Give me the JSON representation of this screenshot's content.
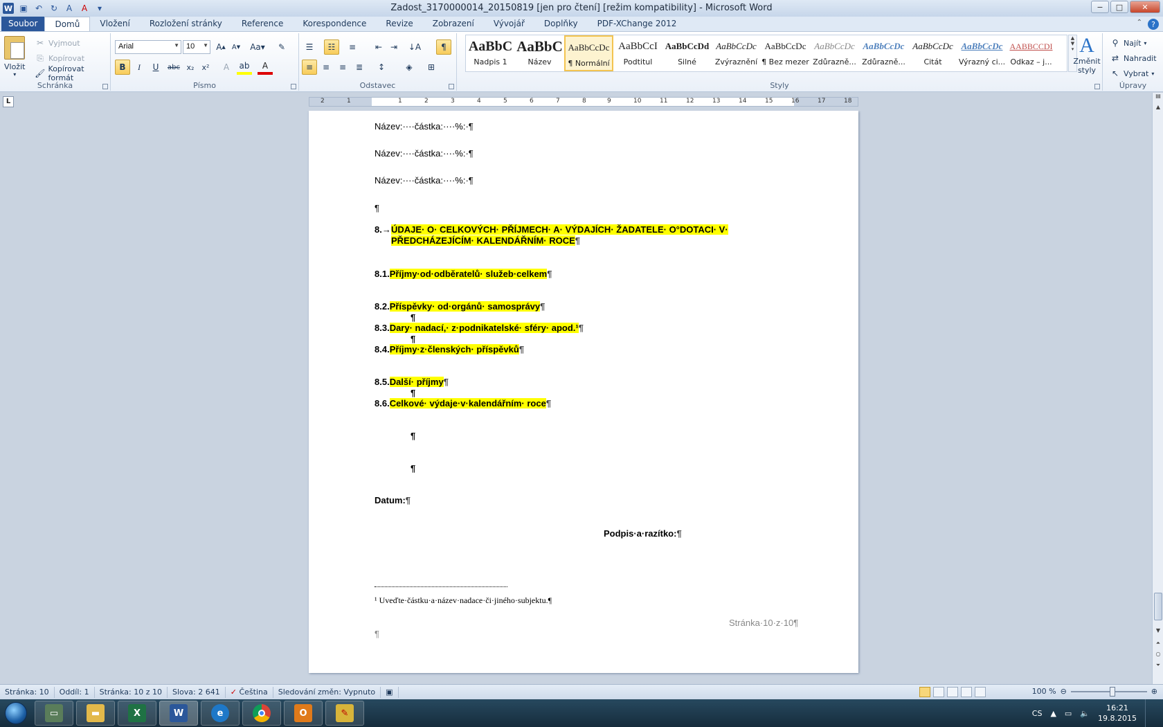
{
  "window": {
    "title": "Zadost_3170000014_20150819 [jen pro čtení] [režim kompatibility] - Microsoft Word",
    "controls": [
      "−",
      "□",
      "✕"
    ]
  },
  "tabs": [
    "Soubor",
    "Domů",
    "Vložení",
    "Rozložení stránky",
    "Reference",
    "Korespondence",
    "Revize",
    "Zobrazení",
    "Vývojář",
    "Doplňky",
    "PDF-XChange 2012"
  ],
  "ribbon": {
    "clipboard": {
      "label": "Schránka",
      "paste": "Vložit",
      "cut": "Vyjmout",
      "copy": "Kopírovat",
      "format_painter": "Kopírovat formát"
    },
    "font": {
      "label": "Písmo",
      "font_name": "Arial",
      "font_size": "10"
    },
    "paragraph": {
      "label": "Odstavec"
    },
    "styles": {
      "label": "Styly",
      "items": [
        {
          "preview": "AaBbC",
          "name": "Nadpis 1"
        },
        {
          "preview": "AaBbC",
          "name": "Název"
        },
        {
          "preview": "AaBbCcDc",
          "name": "¶ Normální"
        },
        {
          "preview": "AaBbCcI",
          "name": "Podtitul"
        },
        {
          "preview": "AaBbCcDd",
          "name": "Silné"
        },
        {
          "preview": "AaBbCcDc",
          "name": "Zvýraznění"
        },
        {
          "preview": "AaBbCcDc",
          "name": "¶ Bez mezer"
        },
        {
          "preview": "AaBbCcDc",
          "name": "Zdůrazně..."
        },
        {
          "preview": "AaBbCcDc",
          "name": "Zdůrazně..."
        },
        {
          "preview": "AaBbCcDc",
          "name": "Citát"
        },
        {
          "preview": "AaBbCcDc",
          "name": "Výrazný ci..."
        },
        {
          "preview": "AABBCCDI",
          "name": "Odkaz – j..."
        }
      ],
      "change_styles": "Změnit styly"
    },
    "editing": {
      "label": "Úpravy",
      "find": "Najít",
      "replace": "Nahradit",
      "select": "Vybrat"
    }
  },
  "ruler": {
    "numbers": [
      "2",
      "1",
      "1",
      "2",
      "3",
      "4",
      "5",
      "6",
      "7",
      "8",
      "9",
      "10",
      "11",
      "12",
      "13",
      "14",
      "15",
      "16",
      "17",
      "18"
    ]
  },
  "document": {
    "field_line": "Název:····částka:····%:·¶",
    "empty_pm": "¶",
    "heading8_num": "8.→",
    "heading8_line1": "ÚDAJE· O· CELKOVÝCH· PŘÍJMECH· A· VÝDAJÍCH· ŽADATELE· O°DOTACI· V·",
    "heading8_line2": "PŘEDCHÁZEJÍCÍM· KALENDÁŘNÍM· ROCE",
    "items": [
      {
        "num": "8.1.",
        "text": "Příjmy·od·odběratelů· služeb·celkem"
      },
      {
        "num": "8.2.",
        "text": "Příspěvky· od·orgánů· samosprávy"
      },
      {
        "num": "8.3.",
        "text": "Dary· nadací,· z·podnikatelské· sféry· apod.¹"
      },
      {
        "num": "8.4.",
        "text": "Příjmy·z·členských· příspěvků"
      },
      {
        "num": "8.5.",
        "text": "Další· příjmy"
      },
      {
        "num": "8.6.",
        "text": "Celkové· výdaje·v·kalendářním· roce"
      }
    ],
    "date_label": "Datum:",
    "signature_label": "Podpis·a·razítko:",
    "footnote": "¹ Uveďte·částku·a·název·nadace·či·jiného·subjektu.¶",
    "page_footer": "Stránka·10·z·10¶"
  },
  "status": {
    "items": [
      "Stránka: 10",
      "Oddíl: 1",
      "Stránka: 10 z 10",
      "Slova: 2 641",
      "Čeština",
      "Sledování změn: Vypnuto"
    ],
    "zoom": "100 %",
    "zoom_fraction": 0.5
  },
  "taskbar": {
    "apps": [
      "explorer",
      "files",
      "excel",
      "word",
      "internet-explorer",
      "chrome",
      "outlook",
      "tool"
    ],
    "lang": "CS",
    "time": "16:21",
    "date": "19.8.2015"
  }
}
